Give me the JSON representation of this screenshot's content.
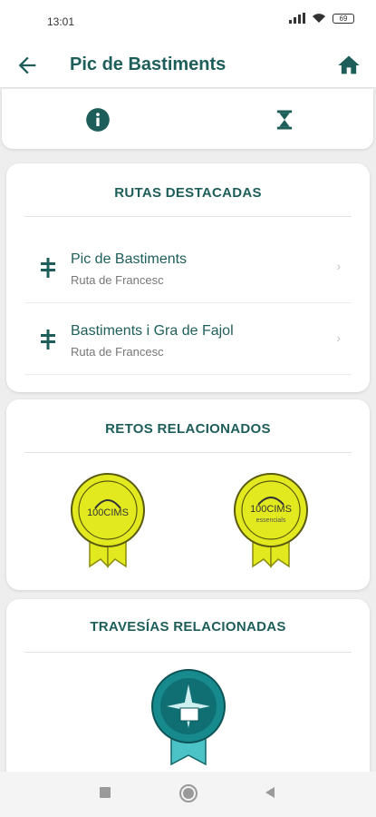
{
  "status": {
    "time": "13:01",
    "battery": "69"
  },
  "header": {
    "title": "Pic de Bastiments",
    "back_icon": "arrow-left-icon",
    "home_icon": "home-icon"
  },
  "tabs": [
    {
      "icon": "info-icon"
    },
    {
      "icon": "hourglass-icon"
    }
  ],
  "featured_routes": {
    "heading": "RUTAS DESTACADAS",
    "items": [
      {
        "name": "Pic de Bastiments",
        "subtitle": "Ruta de Francesc",
        "icon": "signpost-icon"
      },
      {
        "name": "Bastiments i Gra de Fajol",
        "subtitle": "Ruta de Francesc",
        "icon": "signpost-icon"
      }
    ]
  },
  "related_challenges": {
    "heading": "RETOS RELACIONADOS",
    "badges": [
      {
        "text": "100CIMS",
        "subtext": ""
      },
      {
        "text": "100CIMS",
        "subtext": "essencials"
      }
    ]
  },
  "related_crossings": {
    "heading": "TRAVESÍAS RELACIONADAS",
    "badges": [
      {
        "icon": "compass-map-badge-icon"
      }
    ]
  },
  "colors": {
    "primary": "#1e5e5a",
    "badge_yellow": "#e2ea1f",
    "badge_teal": "#178a8e"
  }
}
